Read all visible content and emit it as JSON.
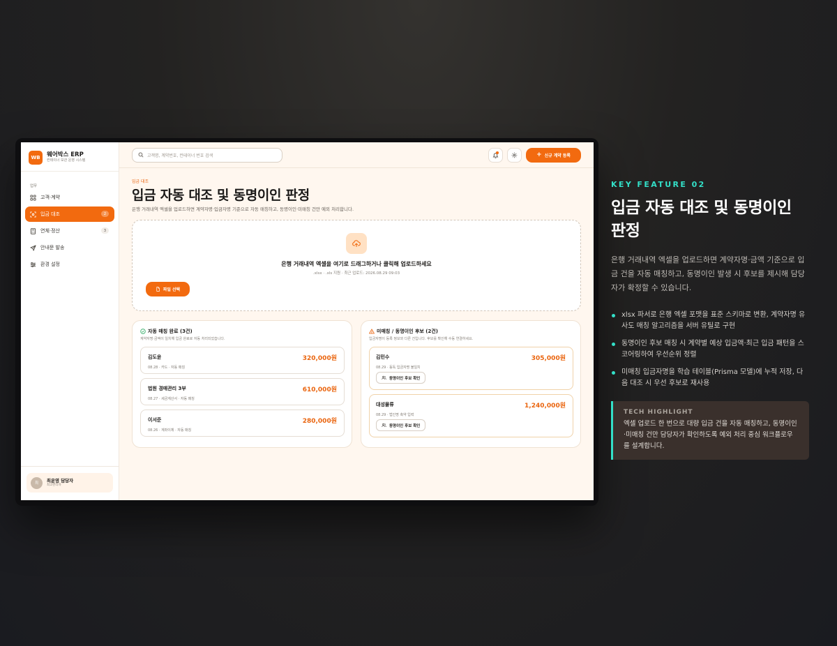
{
  "app": {
    "logo": "WB",
    "name": "웨어박스 ERP",
    "subtitle": "컨테이너 보관 운영 시스템"
  },
  "sidebar": {
    "section_label": "업무",
    "items": [
      {
        "label": "고객·계약",
        "icon": "grid-icon",
        "badge": ""
      },
      {
        "label": "입금 대조",
        "icon": "scan-icon",
        "badge": "2",
        "active": true
      },
      {
        "label": "연체·정산",
        "icon": "calculator-icon",
        "badge": "3"
      },
      {
        "label": "안내문 발송",
        "icon": "send-icon",
        "badge": ""
      },
      {
        "label": "환경 설정",
        "icon": "sliders-icon",
        "badge": ""
      }
    ],
    "user": {
      "avatar": "최",
      "name": "최운영 담당자",
      "role": "최고관리자"
    }
  },
  "header": {
    "search_placeholder": "고객명, 계약번호, 컨테이너 번호 검색",
    "new_contract_label": "신규 계약 등록"
  },
  "page": {
    "eyebrow": "입금 대조",
    "title": "입금 자동 대조 및 동명이인 판정",
    "description": "은행 거래내역 엑셀을 업로드하면 계약자명·입금자명 기준으로 자동 매칭하고, 동명이인·미매칭 건만 예외 처리합니다."
  },
  "upload": {
    "title": "은행 거래내역 엑셀을 여기로 드래그하거나 클릭해 업로드하세요",
    "subtitle": ".xlsx · .xls 지원 · 최근 업로드: 2026.08.29 09:03",
    "button_label": "파일 선택"
  },
  "matched": {
    "title": "자동 매칭 완료 (3건)",
    "description": "계약자명·금액이 일치해 입금 완료로 자동 처리되었습니다.",
    "rows": [
      {
        "name": "김도윤",
        "meta": "08.28 · 카드 · 자동 매칭",
        "amount": "320,000원"
      },
      {
        "name": "법원 경매관리 3부",
        "meta": "08.27 · 세금계산서 · 자동 매칭",
        "amount": "610,000원"
      },
      {
        "name": "이서준",
        "meta": "08.26 · 계좌이체 · 자동 매칭",
        "amount": "280,000원"
      }
    ]
  },
  "unmatched": {
    "title": "미매칭 / 동명이인 후보 (2건)",
    "description": "입금자명이 등록 정보와 다른 건입니다. 후보를 확인해 수동 연결하세요.",
    "rows": [
      {
        "name": "김민수",
        "meta": "08.29 · 동독 입금자명 불일치",
        "amount": "305,000원",
        "button": "동명이인 후보 확인"
      },
      {
        "name": "대성물류",
        "meta": "08.29 · 법인명 축약 입력",
        "amount": "1,240,000원",
        "button": "동명이인 후보 확인"
      }
    ]
  },
  "feature": {
    "tag": "KEY FEATURE 02",
    "title": "입금 자동 대조 및 동명이인 판정",
    "description": "은행 거래내역 엑셀을 업로드하면 계약자명·금액 기준으로 입금 건을 자동 매칭하고, 동명이인 발생 시 후보를 제시해 담당자가 확정할 수 있습니다.",
    "bullets": [
      "xlsx 파서로 은행 엑셀 포맷을 표준 스키마로 변환, 계약자명 유사도 매칭 알고리즘을 서버 유틸로 구현",
      "동명이인 후보 매칭 시 계약별 예상 입금액·최근 입금 패턴을 스코어링하여 우선순위 정렬",
      "미매칭 입금자명을 학습 테이블(Prisma 모델)에 누적 저장, 다음 대조 시 우선 후보로 재사용"
    ],
    "tech_label": "TECH HIGHLIGHT",
    "tech_text": "엑셀 업로드 한 번으로 대량 입금 건을 자동 매칭하고, 동명이인·미매칭 건만 담당자가 확인하도록 예외 처리 중심 워크플로우를 설계합니다."
  },
  "colors": {
    "accent": "#f26a0f",
    "teal": "#33e0c8",
    "background": "#fff7ef"
  }
}
